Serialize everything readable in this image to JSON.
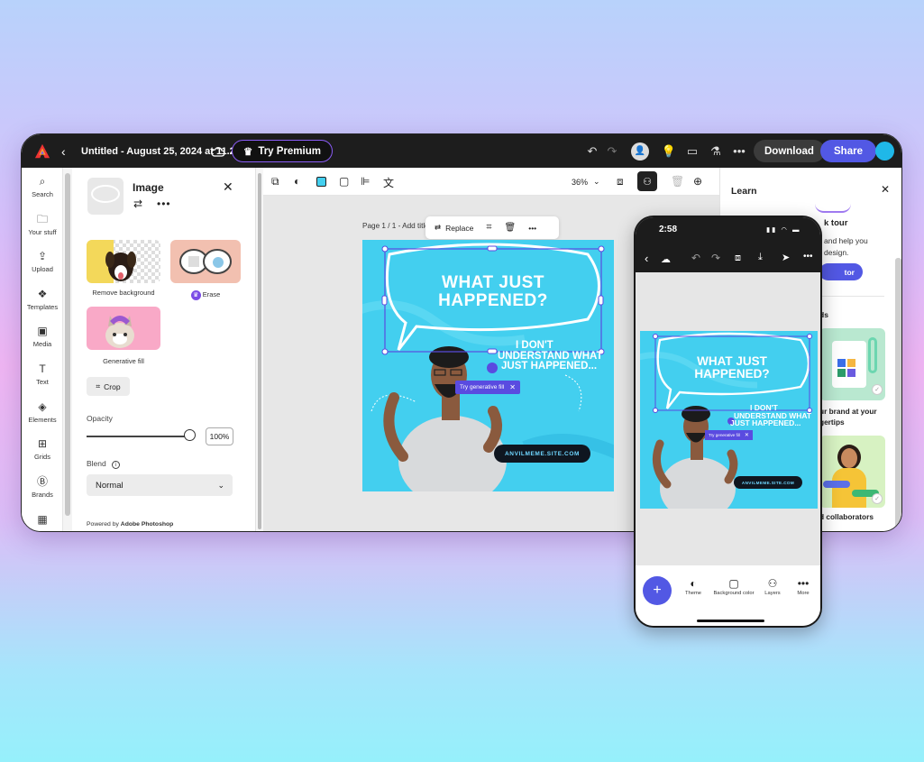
{
  "topbar": {
    "doc_title": "Untitled - August 25, 2024 at 11.22.13",
    "premium_label": "Try Premium",
    "download_label": "Download",
    "share_label": "Share"
  },
  "rail": {
    "items": [
      {
        "label": "Search",
        "icon": "search-icon"
      },
      {
        "label": "Your stuff",
        "icon": "folder-icon"
      },
      {
        "label": "Upload",
        "icon": "upload-icon"
      },
      {
        "label": "Templates",
        "icon": "templates-icon"
      },
      {
        "label": "Media",
        "icon": "media-icon"
      },
      {
        "label": "Text",
        "icon": "text-icon"
      },
      {
        "label": "Elements",
        "icon": "elements-icon"
      },
      {
        "label": "Grids",
        "icon": "grids-icon"
      },
      {
        "label": "Brands",
        "icon": "brands-icon"
      }
    ]
  },
  "panel": {
    "title": "Image",
    "tools": [
      {
        "label": "Remove background"
      },
      {
        "label": "Erase"
      },
      {
        "label": "Generative fill"
      }
    ],
    "crop_label": "Crop",
    "opacity_label": "Opacity",
    "opacity_value": "100%",
    "blend_label": "Blend",
    "blend_value": "Normal",
    "powered_prefix": "Powered by ",
    "powered_brand": "Adobe Photoshop"
  },
  "canvas": {
    "zoom": "36%",
    "page_label": "Page 1 / 1 - Add title",
    "replace_label": "Replace",
    "headline_1": "WHAT JUST",
    "headline_2": "HAPPENED?",
    "sub_1": "I DON'T",
    "sub_2": "UNDERSTAND WHAT",
    "sub_3": "JUST HAPPENED...",
    "url": "ANVILMEME.SITE.COM",
    "gen_fill_label": "Try generative fill"
  },
  "learn": {
    "title": "Learn",
    "tour_title": "k tour",
    "tour_text_1": "and help you",
    "tour_text_2": "design.",
    "tour_button": "tor",
    "section_label": "ds",
    "card1_label_1": "ur brand at your",
    "card1_label_2": "gertips",
    "card2_label": "d collaborators"
  },
  "phone": {
    "time": "2:58",
    "bottom_items": [
      {
        "label": "Theme"
      },
      {
        "label": "Background color"
      },
      {
        "label": "Layers"
      },
      {
        "label": "More"
      }
    ]
  },
  "colors": {
    "accent": "#5258e4",
    "premium_border": "#8a5cf6",
    "design_bg": "#43cfef",
    "topbar_bg": "#1d1d1d"
  }
}
